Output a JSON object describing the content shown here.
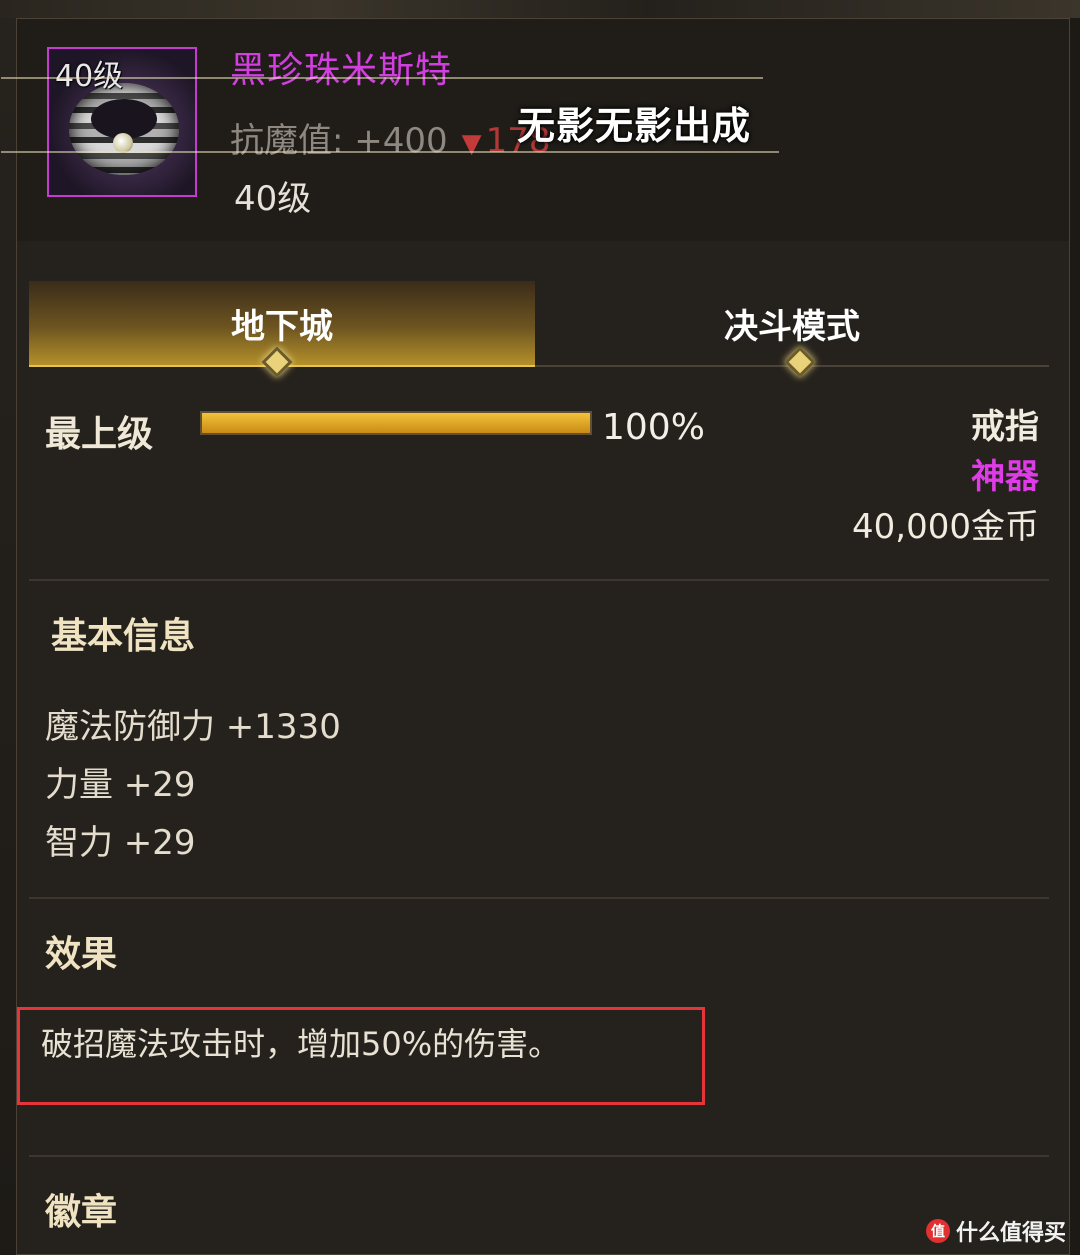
{
  "item": {
    "icon_level": "40级",
    "name": "黑珍珠米斯特",
    "stat_label": "抗魔值: +400",
    "stat_delta": "178",
    "level": "40级"
  },
  "overlay_title": "无影无影出成",
  "tabs": [
    {
      "label": "地下城",
      "active": true
    },
    {
      "label": "决斗模式",
      "active": false
    }
  ],
  "grade": {
    "label": "最上级",
    "percent_text": "100%",
    "percent_value": 100
  },
  "type_info": {
    "slot": "戒指",
    "rarity": "神器",
    "rarity_color": "#df3be8",
    "price": "40,000金币"
  },
  "basic_info": {
    "title": "基本信息",
    "lines": [
      "魔法防御力 +1330",
      "力量 +29",
      "智力 +29"
    ]
  },
  "effect": {
    "title": "效果",
    "text": "破招魔法攻击时，增加50%的伤害。"
  },
  "emblem": {
    "title": "徽章"
  },
  "watermark": {
    "logo": "值",
    "text": "什么值得买"
  },
  "colors": {
    "accent_gold": "#e6c24f",
    "highlight_box": "#e5343a",
    "name_purple": "#d23ee0"
  }
}
